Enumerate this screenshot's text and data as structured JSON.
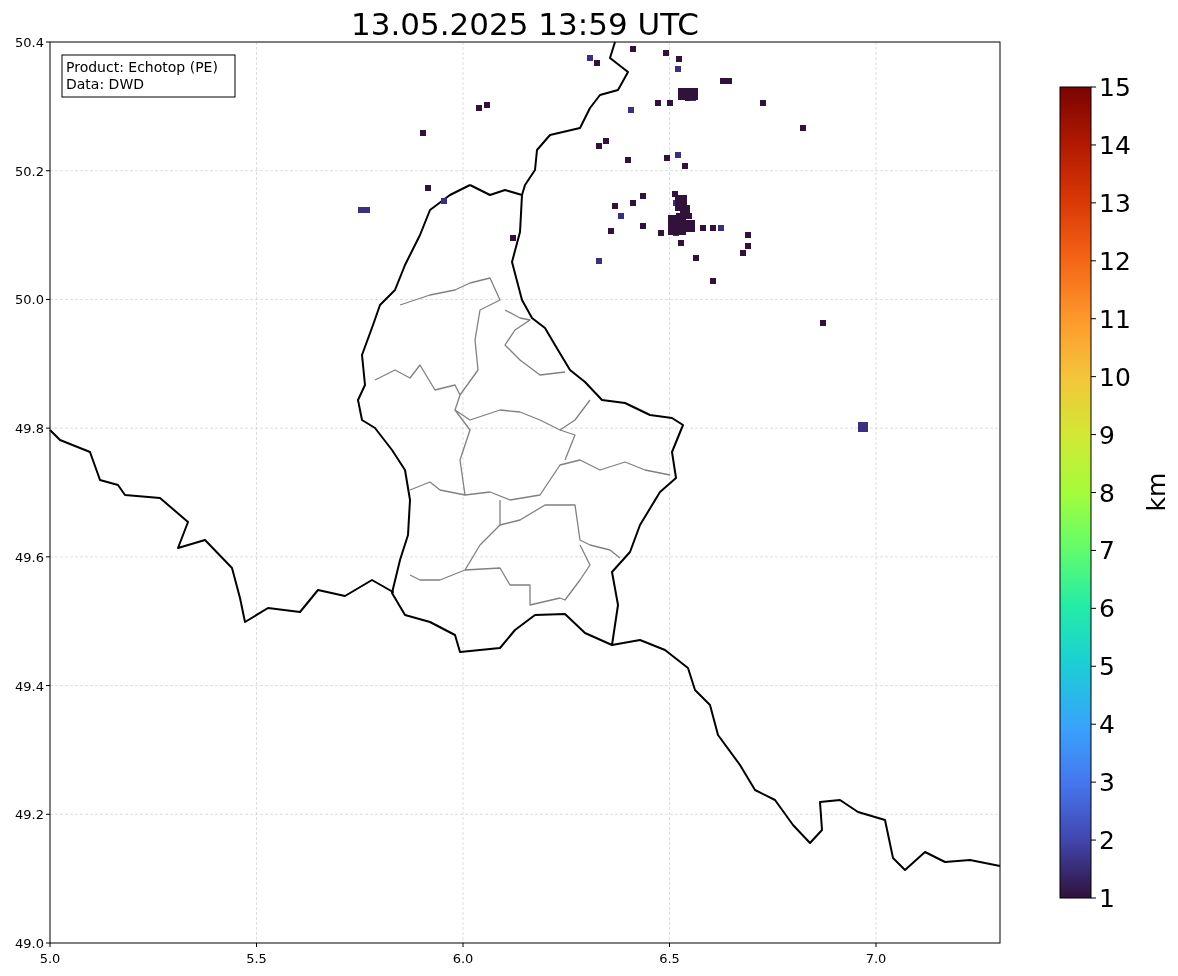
{
  "title": "13.05.2025 13:59 UTC",
  "info_box": [
    "Product: Echotop (PE)",
    "Data: DWD"
  ],
  "x_ticks": [
    "5.0",
    "5.5",
    "6.0",
    "6.5",
    "7.0"
  ],
  "y_ticks": [
    "50.4",
    "50.2",
    "50.0",
    "49.8",
    "49.6",
    "49.4",
    "49.2",
    "49.0"
  ],
  "colorbar": {
    "label": "km",
    "ticks": [
      "15",
      "14",
      "13",
      "12",
      "11",
      "10",
      "9",
      "8",
      "7",
      "6",
      "5",
      "4",
      "3",
      "2",
      "1"
    ]
  }
}
